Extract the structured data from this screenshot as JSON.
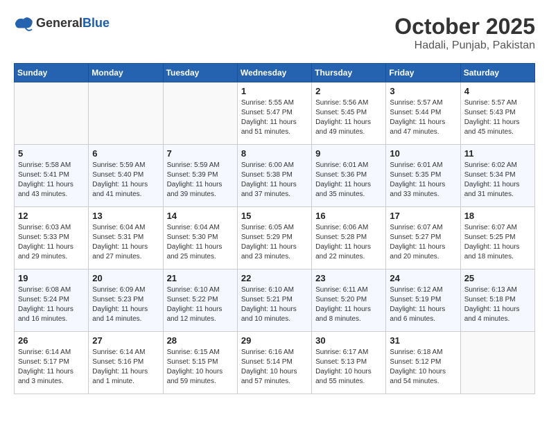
{
  "logo": {
    "general": "General",
    "blue": "Blue"
  },
  "title": {
    "month": "October 2025",
    "location": "Hadali, Punjab, Pakistan"
  },
  "weekdays": [
    "Sunday",
    "Monday",
    "Tuesday",
    "Wednesday",
    "Thursday",
    "Friday",
    "Saturday"
  ],
  "weeks": [
    [
      {
        "day": "",
        "info": ""
      },
      {
        "day": "",
        "info": ""
      },
      {
        "day": "",
        "info": ""
      },
      {
        "day": "1",
        "info": "Sunrise: 5:55 AM\nSunset: 5:47 PM\nDaylight: 11 hours\nand 51 minutes."
      },
      {
        "day": "2",
        "info": "Sunrise: 5:56 AM\nSunset: 5:45 PM\nDaylight: 11 hours\nand 49 minutes."
      },
      {
        "day": "3",
        "info": "Sunrise: 5:57 AM\nSunset: 5:44 PM\nDaylight: 11 hours\nand 47 minutes."
      },
      {
        "day": "4",
        "info": "Sunrise: 5:57 AM\nSunset: 5:43 PM\nDaylight: 11 hours\nand 45 minutes."
      }
    ],
    [
      {
        "day": "5",
        "info": "Sunrise: 5:58 AM\nSunset: 5:41 PM\nDaylight: 11 hours\nand 43 minutes."
      },
      {
        "day": "6",
        "info": "Sunrise: 5:59 AM\nSunset: 5:40 PM\nDaylight: 11 hours\nand 41 minutes."
      },
      {
        "day": "7",
        "info": "Sunrise: 5:59 AM\nSunset: 5:39 PM\nDaylight: 11 hours\nand 39 minutes."
      },
      {
        "day": "8",
        "info": "Sunrise: 6:00 AM\nSunset: 5:38 PM\nDaylight: 11 hours\nand 37 minutes."
      },
      {
        "day": "9",
        "info": "Sunrise: 6:01 AM\nSunset: 5:36 PM\nDaylight: 11 hours\nand 35 minutes."
      },
      {
        "day": "10",
        "info": "Sunrise: 6:01 AM\nSunset: 5:35 PM\nDaylight: 11 hours\nand 33 minutes."
      },
      {
        "day": "11",
        "info": "Sunrise: 6:02 AM\nSunset: 5:34 PM\nDaylight: 11 hours\nand 31 minutes."
      }
    ],
    [
      {
        "day": "12",
        "info": "Sunrise: 6:03 AM\nSunset: 5:33 PM\nDaylight: 11 hours\nand 29 minutes."
      },
      {
        "day": "13",
        "info": "Sunrise: 6:04 AM\nSunset: 5:31 PM\nDaylight: 11 hours\nand 27 minutes."
      },
      {
        "day": "14",
        "info": "Sunrise: 6:04 AM\nSunset: 5:30 PM\nDaylight: 11 hours\nand 25 minutes."
      },
      {
        "day": "15",
        "info": "Sunrise: 6:05 AM\nSunset: 5:29 PM\nDaylight: 11 hours\nand 23 minutes."
      },
      {
        "day": "16",
        "info": "Sunrise: 6:06 AM\nSunset: 5:28 PM\nDaylight: 11 hours\nand 22 minutes."
      },
      {
        "day": "17",
        "info": "Sunrise: 6:07 AM\nSunset: 5:27 PM\nDaylight: 11 hours\nand 20 minutes."
      },
      {
        "day": "18",
        "info": "Sunrise: 6:07 AM\nSunset: 5:25 PM\nDaylight: 11 hours\nand 18 minutes."
      }
    ],
    [
      {
        "day": "19",
        "info": "Sunrise: 6:08 AM\nSunset: 5:24 PM\nDaylight: 11 hours\nand 16 minutes."
      },
      {
        "day": "20",
        "info": "Sunrise: 6:09 AM\nSunset: 5:23 PM\nDaylight: 11 hours\nand 14 minutes."
      },
      {
        "day": "21",
        "info": "Sunrise: 6:10 AM\nSunset: 5:22 PM\nDaylight: 11 hours\nand 12 minutes."
      },
      {
        "day": "22",
        "info": "Sunrise: 6:10 AM\nSunset: 5:21 PM\nDaylight: 11 hours\nand 10 minutes."
      },
      {
        "day": "23",
        "info": "Sunrise: 6:11 AM\nSunset: 5:20 PM\nDaylight: 11 hours\nand 8 minutes."
      },
      {
        "day": "24",
        "info": "Sunrise: 6:12 AM\nSunset: 5:19 PM\nDaylight: 11 hours\nand 6 minutes."
      },
      {
        "day": "25",
        "info": "Sunrise: 6:13 AM\nSunset: 5:18 PM\nDaylight: 11 hours\nand 4 minutes."
      }
    ],
    [
      {
        "day": "26",
        "info": "Sunrise: 6:14 AM\nSunset: 5:17 PM\nDaylight: 11 hours\nand 3 minutes."
      },
      {
        "day": "27",
        "info": "Sunrise: 6:14 AM\nSunset: 5:16 PM\nDaylight: 11 hours\nand 1 minute."
      },
      {
        "day": "28",
        "info": "Sunrise: 6:15 AM\nSunset: 5:15 PM\nDaylight: 10 hours\nand 59 minutes."
      },
      {
        "day": "29",
        "info": "Sunrise: 6:16 AM\nSunset: 5:14 PM\nDaylight: 10 hours\nand 57 minutes."
      },
      {
        "day": "30",
        "info": "Sunrise: 6:17 AM\nSunset: 5:13 PM\nDaylight: 10 hours\nand 55 minutes."
      },
      {
        "day": "31",
        "info": "Sunrise: 6:18 AM\nSunset: 5:12 PM\nDaylight: 10 hours\nand 54 minutes."
      },
      {
        "day": "",
        "info": ""
      }
    ]
  ]
}
